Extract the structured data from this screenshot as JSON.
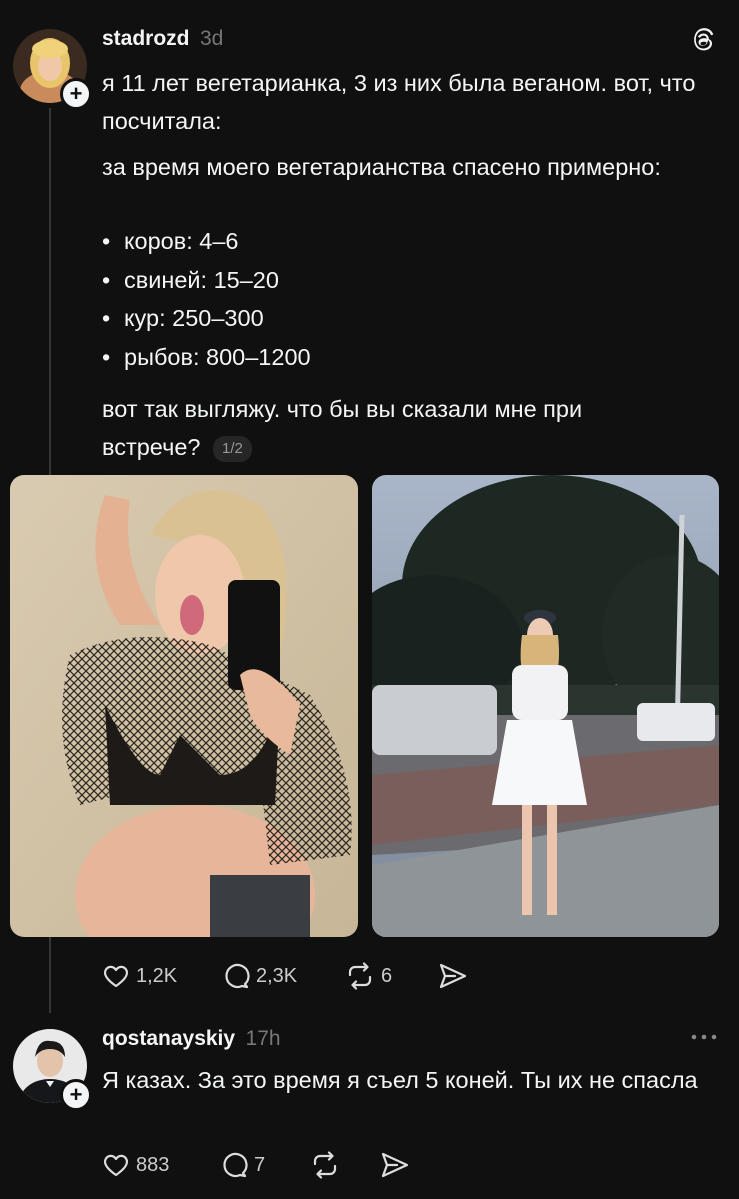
{
  "post": {
    "username": "stadrozd",
    "time": "3d",
    "intro": "я 11 лет вегетарианка, 3 из них была веганом. вот, что посчитала:",
    "para2": "за время моего вегетарианства спасено примерно:",
    "bullets": [
      "коров: 4–6",
      "свиней: 15–20",
      "кур: 250–300",
      "рыбов: 800–1200"
    ],
    "question": "вот так выгляжу. что бы вы сказали мне при встрече?",
    "pager": "1/2",
    "likes": "1,2K",
    "comments": "2,3K",
    "reposts": "6"
  },
  "reply": {
    "username": "qostanayskiy",
    "time": "17h",
    "text": "Я казах. За это время я съел 5 коней. Ты их не спасла",
    "likes": "883",
    "comments": "7"
  },
  "icons": {
    "app_logo": "threads-icon",
    "follow": "plus-icon",
    "like": "heart-icon",
    "comment": "comment-icon",
    "repost": "repost-icon",
    "share": "send-icon",
    "more": "more-icon"
  },
  "colors": {
    "background": "#101010",
    "text": "#f3f5f7",
    "muted": "#777777",
    "thread_line": "#333638"
  }
}
